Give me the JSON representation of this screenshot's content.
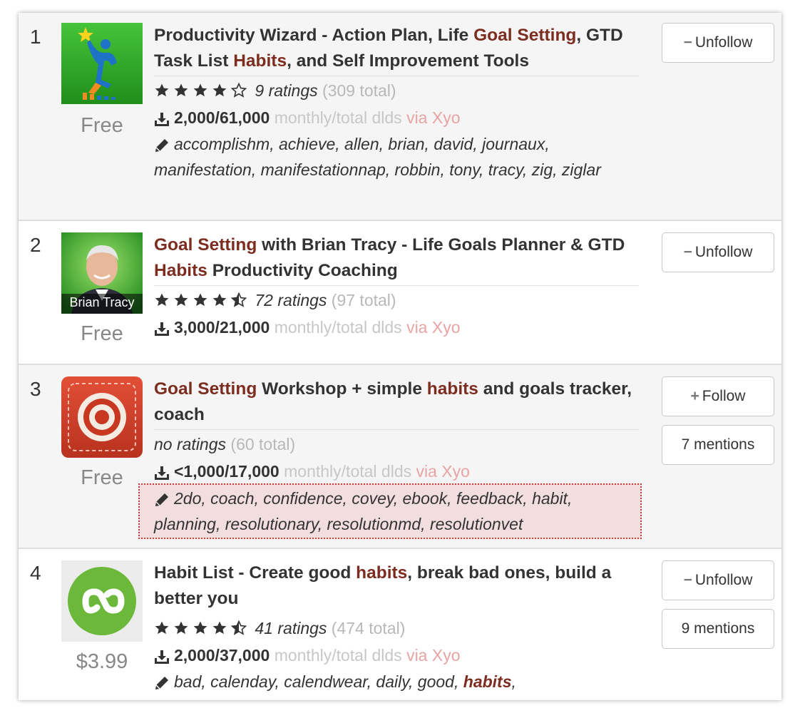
{
  "apps": [
    {
      "rank": "1",
      "title_parts": [
        {
          "text": "Productivity Wizard - Action Plan, Life ",
          "hl": false
        },
        {
          "text": "Goal Setting",
          "hl": true
        },
        {
          "text": ", GTD Task List ",
          "hl": false
        },
        {
          "text": "Habits",
          "hl": true
        },
        {
          "text": ", and Self Improvement Tools",
          "hl": false
        }
      ],
      "stars": 4,
      "ratings_text": "9 ratings",
      "total_text": "(309 total)",
      "downloads": "2,000/61,000",
      "dl_label": "monthly/total dlds",
      "via": "via Xyo",
      "tags": "accomplishm, achieve, allen, brian, david, journaux, manifestation, manifestationnap, robbin, tony, tracy, zig, ziglar",
      "price": "Free",
      "button": "Unfollow",
      "button_icon": "minus-icon",
      "icon": "productivity-wizard-app-icon"
    },
    {
      "rank": "2",
      "title_parts": [
        {
          "text": "Goal Setting",
          "hl": true
        },
        {
          "text": " with Brian Tracy - Life Goals Planner & GTD ",
          "hl": false
        },
        {
          "text": "Habits",
          "hl": true
        },
        {
          "text": " Productivity Coaching",
          "hl": false
        }
      ],
      "stars": 4.5,
      "ratings_text": "72 ratings",
      "total_text": "(97 total)",
      "downloads": "3,000/21,000",
      "dl_label": "monthly/total dlds",
      "via": "via Xyo",
      "icon_caption": "Brian Tracy",
      "price": "Free",
      "button": "Unfollow",
      "button_icon": "minus-icon",
      "icon": "brian-tracy-app-icon"
    },
    {
      "rank": "3",
      "title_parts": [
        {
          "text": "Goal Setting",
          "hl": true
        },
        {
          "text": " Workshop + simple ",
          "hl": false
        },
        {
          "text": "habits",
          "hl": true
        },
        {
          "text": " and goals tracker, coach",
          "hl": false
        }
      ],
      "ratings_text": "no ratings",
      "total_text": "(60 total)",
      "downloads": "<1,000/17,000",
      "dl_label": "monthly/total dlds",
      "via": "via Xyo",
      "tags": "2do, coach, confidence, covey, ebook, feedback, habit, planning, resolutionary, resolutionmd, resolutionvet",
      "price": "Free",
      "button": "Follow",
      "button_icon": "plus-icon",
      "mentions": "7 mentions",
      "icon": "target-app-icon"
    },
    {
      "rank": "4",
      "title_parts": [
        {
          "text": "Habit List - Create good ",
          "hl": false
        },
        {
          "text": "habits",
          "hl": true
        },
        {
          "text": ", break bad ones, build a better you",
          "hl": false
        }
      ],
      "stars": 4.5,
      "ratings_text": "41 ratings",
      "total_text": "(474 total)",
      "downloads": "2,000/37,000",
      "dl_label": "monthly/total dlds",
      "via": "via Xyo",
      "tags_prefix": "bad, calenday, calendwear, daily, good, ",
      "tags_hl": "habits",
      "tags_suffix": ",",
      "price": "$3.99",
      "button": "Unfollow",
      "button_icon": "minus-icon",
      "mentions": "9 mentions",
      "icon": "habit-list-app-icon"
    }
  ],
  "colors": {
    "highlight": "#7c2d1f",
    "muted": "#b8b8b8",
    "via": "#e8a4a4",
    "row_gray": "#f5f5f5",
    "tag_box_bg": "#f2dede",
    "tag_box_border": "#c43b3b"
  }
}
